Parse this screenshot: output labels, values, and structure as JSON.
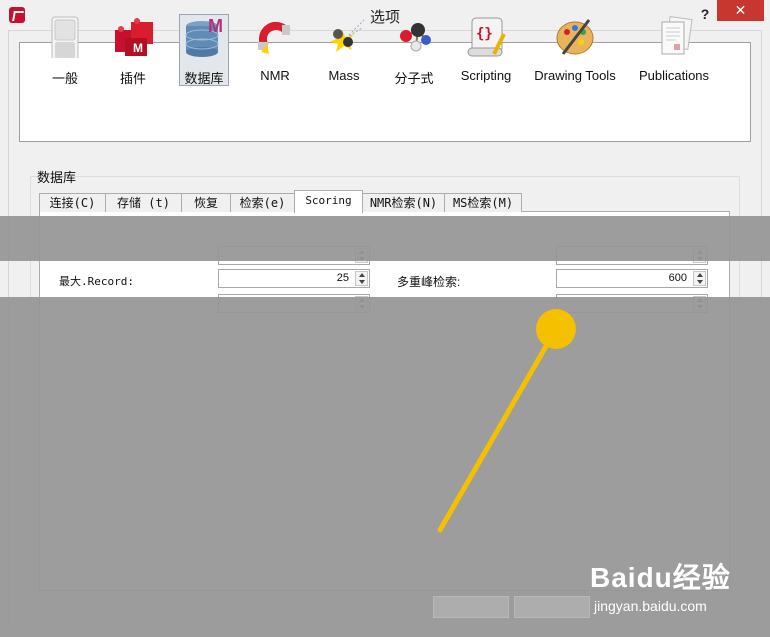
{
  "window": {
    "title": "选项",
    "help_label": "?",
    "close_label": "✕"
  },
  "categories": [
    {
      "label": "一般",
      "icon": "switch-icon"
    },
    {
      "label": "插件",
      "icon": "plugin-blocks-icon"
    },
    {
      "label": "数据库",
      "icon": "database-icon",
      "selected": true
    },
    {
      "label": "NMR",
      "icon": "magnet-icon"
    },
    {
      "label": "Mass",
      "icon": "mass-spec-icon"
    },
    {
      "label": "分子式",
      "icon": "molecule-icon"
    },
    {
      "label": "Scripting",
      "icon": "script-scroll-icon"
    },
    {
      "label": "Drawing Tools",
      "icon": "palette-icon"
    },
    {
      "label": "Publications",
      "icon": "documents-icon"
    }
  ],
  "database": {
    "group_label": "数据库",
    "tabs": [
      {
        "label": "连接(C)"
      },
      {
        "label": "存储 (t)"
      },
      {
        "label": "恢复"
      },
      {
        "label": "检索(e)"
      },
      {
        "label": "Scoring",
        "active": true
      },
      {
        "label": "NMR检索(N)"
      },
      {
        "label": "MS检索(M)"
      }
    ],
    "fields": {
      "max_record_label": "最大.Record:",
      "max_record_value": "25",
      "multi_peak_label": "多重峰检索:",
      "multi_peak_value": "600"
    }
  },
  "watermark": {
    "main": "Baidu经验",
    "sub": "jingyan.baidu.com"
  },
  "colors": {
    "close_button": "#c7372f",
    "pointer": "#f5c000",
    "overlay": "#969696"
  }
}
